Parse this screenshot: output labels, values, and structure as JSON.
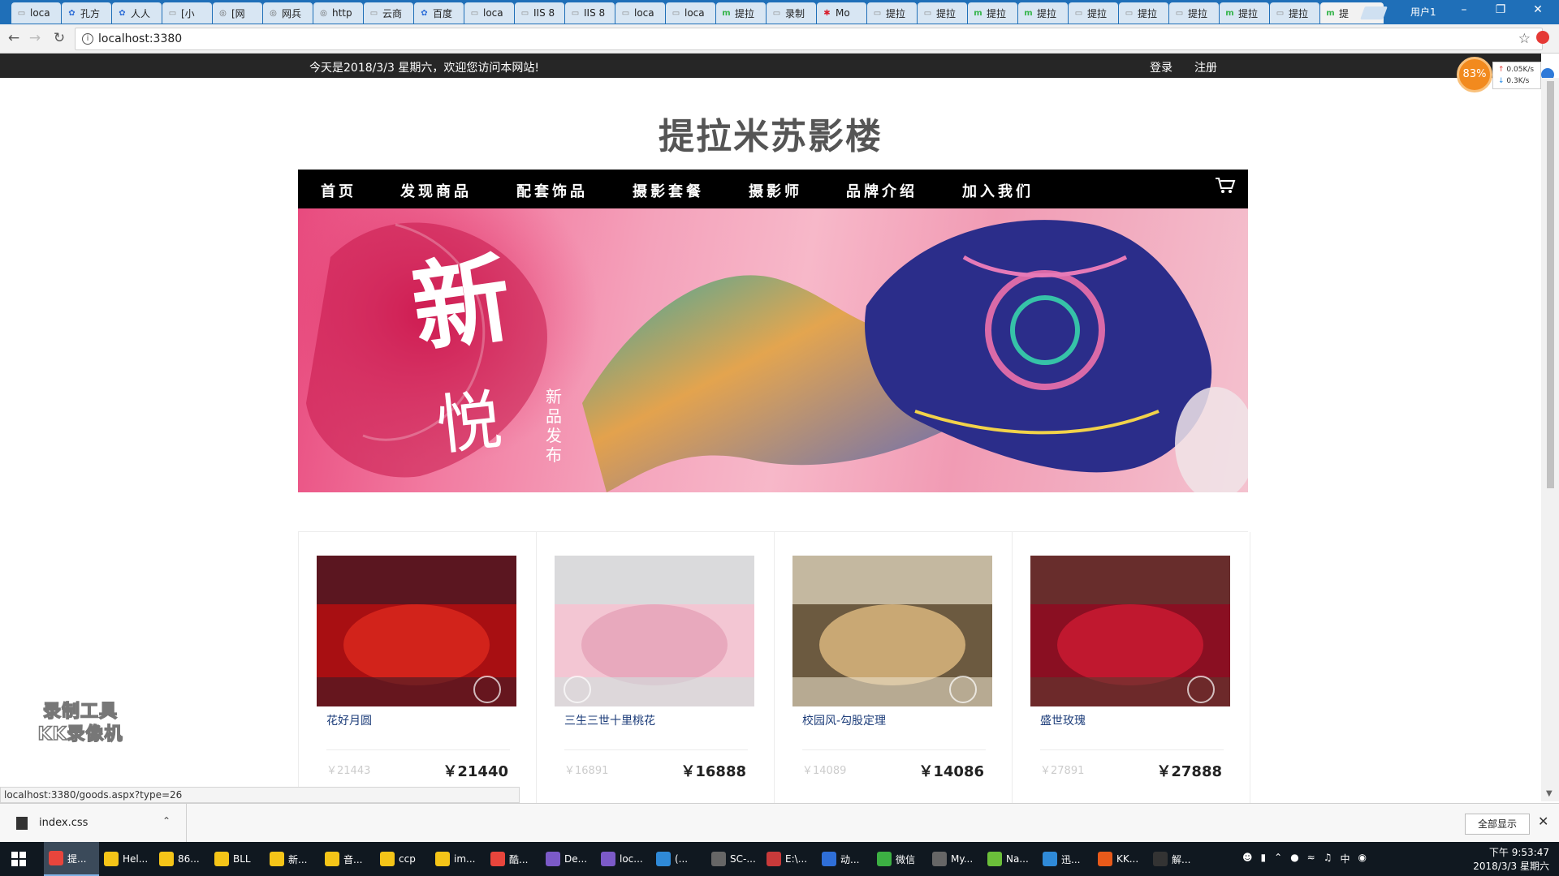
{
  "browser": {
    "tabs": [
      {
        "label": "loca",
        "icon": "page-icon",
        "color": "#888888"
      },
      {
        "label": "孔方",
        "icon": "baidu-icon",
        "color": "#2f6fd8"
      },
      {
        "label": "人人",
        "icon": "baidu-icon",
        "color": "#2f6fd8"
      },
      {
        "label": "[小",
        "icon": "page-icon",
        "color": "#888888"
      },
      {
        "label": "[网",
        "icon": "globe-icon",
        "color": "#666666"
      },
      {
        "label": "网兵",
        "icon": "globe-icon",
        "color": "#666666"
      },
      {
        "label": "http",
        "icon": "globe-icon",
        "color": "#666666"
      },
      {
        "label": "云商",
        "icon": "page-icon",
        "color": "#888888"
      },
      {
        "label": "百度",
        "icon": "baidu-icon",
        "color": "#2f6fd8"
      },
      {
        "label": "loca",
        "icon": "page-icon",
        "color": "#888888"
      },
      {
        "label": "IIS 8",
        "icon": "page-icon",
        "color": "#888888"
      },
      {
        "label": "IIS 8",
        "icon": "page-icon",
        "color": "#888888"
      },
      {
        "label": "loca",
        "icon": "page-icon",
        "color": "#888888"
      },
      {
        "label": "loca",
        "icon": "page-icon",
        "color": "#888888"
      },
      {
        "label": "提拉",
        "icon": "m-icon",
        "color": "#35b44a"
      },
      {
        "label": "录制",
        "icon": "page-icon",
        "color": "#888888"
      },
      {
        "label": "Mo",
        "icon": "huawei-icon",
        "color": "#d81e2c"
      },
      {
        "label": "提拉",
        "icon": "page-icon",
        "color": "#888888"
      },
      {
        "label": "提拉",
        "icon": "page-icon",
        "color": "#888888"
      },
      {
        "label": "提拉",
        "icon": "m-icon",
        "color": "#35b44a"
      },
      {
        "label": "提拉",
        "icon": "m-icon",
        "color": "#35b44a"
      },
      {
        "label": "提拉",
        "icon": "page-icon",
        "color": "#888888"
      },
      {
        "label": "提拉",
        "icon": "page-icon",
        "color": "#888888"
      },
      {
        "label": "提拉",
        "icon": "page-icon",
        "color": "#888888"
      },
      {
        "label": "提拉",
        "icon": "m-icon",
        "color": "#35b44a"
      },
      {
        "label": "提拉",
        "icon": "page-icon",
        "color": "#888888"
      }
    ],
    "active_tab": {
      "label": "提",
      "icon": "m-icon",
      "color": "#35b44a"
    },
    "profile": "用户1",
    "url": "localhost:3380"
  },
  "site": {
    "welcome": "今天是2018/3/3 星期六，欢迎您访问本网站!",
    "login": "登录",
    "register": "注册",
    "title": "提拉米苏影楼",
    "nav": [
      "首页",
      "发现商品",
      "配套饰品",
      "摄影套餐",
      "摄影师",
      "品牌介绍",
      "加入我们"
    ],
    "banner": {
      "headline": "新",
      "sub": "悦",
      "tag": "新品发布"
    }
  },
  "products": [
    {
      "name": "花好月圆",
      "old_price": "￥21443",
      "price": "￥21440",
      "palette": [
        "#a80f12",
        "#d2231b",
        "#3a1a26"
      ]
    },
    {
      "name": "三生三世十里桃花",
      "old_price": "￥16891",
      "price": "￥16888",
      "palette": [
        "#f3c6d3",
        "#e8a9bd",
        "#cfe3e0"
      ]
    },
    {
      "name": "校园风-勾股定理",
      "old_price": "￥14089",
      "price": "￥14086",
      "palette": [
        "#6c5a40",
        "#c9a874",
        "#e9dfc9"
      ]
    },
    {
      "name": "盛世玫瑰",
      "old_price": "￥27891",
      "price": "￥27888",
      "palette": [
        "#8a0f22",
        "#c0182f",
        "#5a3a30"
      ]
    }
  ],
  "speed": {
    "percent": "83%",
    "up": "0.05K/s",
    "down": "0.3K/s"
  },
  "status_url": "localhost:3380/goods.aspx?type=26",
  "watermark": [
    "录制工具",
    "KK录像机"
  ],
  "downloads": {
    "file": "index.css",
    "show_all": "全部显示"
  },
  "taskbar": {
    "items": [
      {
        "label": "提...",
        "color": "#e8453c",
        "active": true
      },
      {
        "label": "Hel...",
        "color": "#f5c518"
      },
      {
        "label": "86...",
        "color": "#f5c518"
      },
      {
        "label": "BLL",
        "color": "#f5c518"
      },
      {
        "label": "新...",
        "color": "#f5c518"
      },
      {
        "label": "音...",
        "color": "#f5c518"
      },
      {
        "label": "ccp",
        "color": "#f5c518"
      },
      {
        "label": "im...",
        "color": "#f5c518"
      },
      {
        "label": "酷...",
        "color": "#e8453c"
      },
      {
        "label": "De...",
        "color": "#7b5ac8"
      },
      {
        "label": "loc...",
        "color": "#7b5ac8"
      },
      {
        "label": "(...",
        "color": "#2f8ad8"
      },
      {
        "label": "SC-...",
        "color": "#666666"
      },
      {
        "label": "E:\\...",
        "color": "#c83a3a"
      },
      {
        "label": "动...",
        "color": "#2f6fd8"
      },
      {
        "label": "微信",
        "color": "#3cb043"
      },
      {
        "label": "My...",
        "color": "#666666"
      },
      {
        "label": "Na...",
        "color": "#6bbf3a"
      },
      {
        "label": "迅...",
        "color": "#2f8ad8"
      },
      {
        "label": "KK...",
        "color": "#e85a1a"
      },
      {
        "label": "解...",
        "color": "#333333"
      }
    ],
    "tray": [
      "中"
    ],
    "time": "下午 9:53:47",
    "date": "2018/3/3 星期六"
  }
}
